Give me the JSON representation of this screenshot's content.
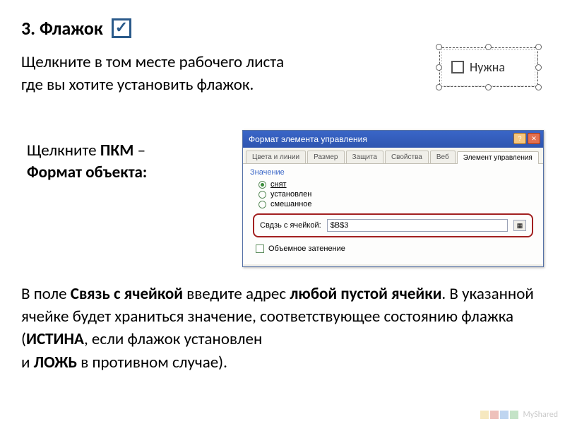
{
  "heading": "3. Флажок",
  "para1a": "Щелкните в том месте рабочего листа",
  "para1b": "где вы хотите установить флажок.",
  "checkbox_sample_label": "Нужна",
  "instr2_line1_a": "Щелкните ",
  "instr2_line1_b": "ПКМ",
  "instr2_line1_c": " –",
  "instr2_line2": "Формат объекта:",
  "dialog": {
    "title": "Формат элемента управления",
    "tabs": [
      "Цвета и линии",
      "Размер",
      "Защита",
      "Свойства",
      "Веб",
      "Элемент управления"
    ],
    "group_label": "Значение",
    "radios": [
      "снят",
      "установлен",
      "смешанное"
    ],
    "cell_link_label": "Свдзь с ячейкой:",
    "cell_link_value": "$B$3",
    "shadow_label": "Объемное затенение"
  },
  "bottom": {
    "t1": "В поле ",
    "t2": "Связь с ячейкой",
    "t3": " введите адрес ",
    "t4": "любой пустой ячейки",
    "t5": ". В указанной ячейке будет храниться значение, соответствующее состоянию флажка (",
    "t6": "ИСТИНА",
    "t7": ", если флажок установлен",
    "t8": "и ",
    "t9": "ЛОЖЬ",
    "t10": " в противном случае)."
  },
  "watermark": "MyShared"
}
